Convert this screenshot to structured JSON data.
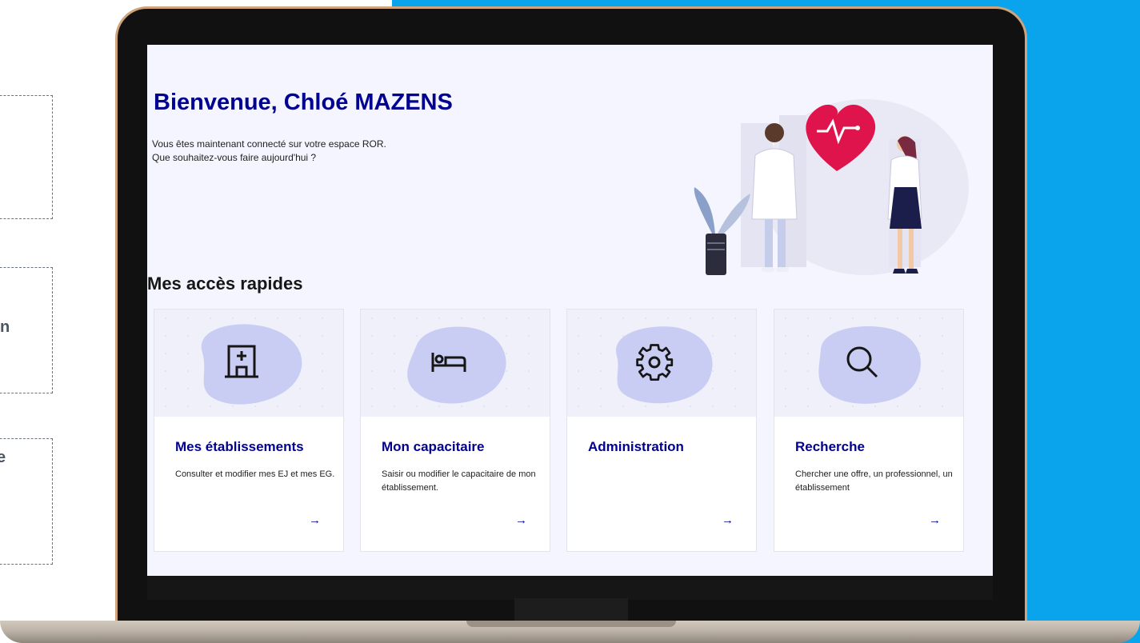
{
  "left_fragments": {
    "box2": "n",
    "box3": "e"
  },
  "welcome": {
    "title": "Bienvenue, Chloé MAZENS",
    "line1": "Vous êtes maintenant connecté sur votre espace ROR.",
    "line2": "Que souhaitez-vous faire aujourd'hui ?"
  },
  "quick_access": {
    "title": "Mes accès rapides",
    "cards": [
      {
        "icon": "hospital-icon",
        "title": "Mes établissements",
        "description": "Consulter et modifier mes EJ et mes EG.",
        "arrow": "→"
      },
      {
        "icon": "bed-icon",
        "title": "Mon capacitaire",
        "description": "Saisir ou modifier le capacitaire de mon établissement.",
        "arrow": "→"
      },
      {
        "icon": "gear-icon",
        "title": "Administration",
        "description": "",
        "arrow": "→"
      },
      {
        "icon": "search-icon",
        "title": "Recherche",
        "description": "Chercher une offre, un professionnel, un établissement",
        "arrow": "→"
      }
    ]
  },
  "colors": {
    "primary": "#000091",
    "screen_bg": "#f5f5ff",
    "accent_blue": "#0aa4ec",
    "heart": "#e0144c"
  }
}
